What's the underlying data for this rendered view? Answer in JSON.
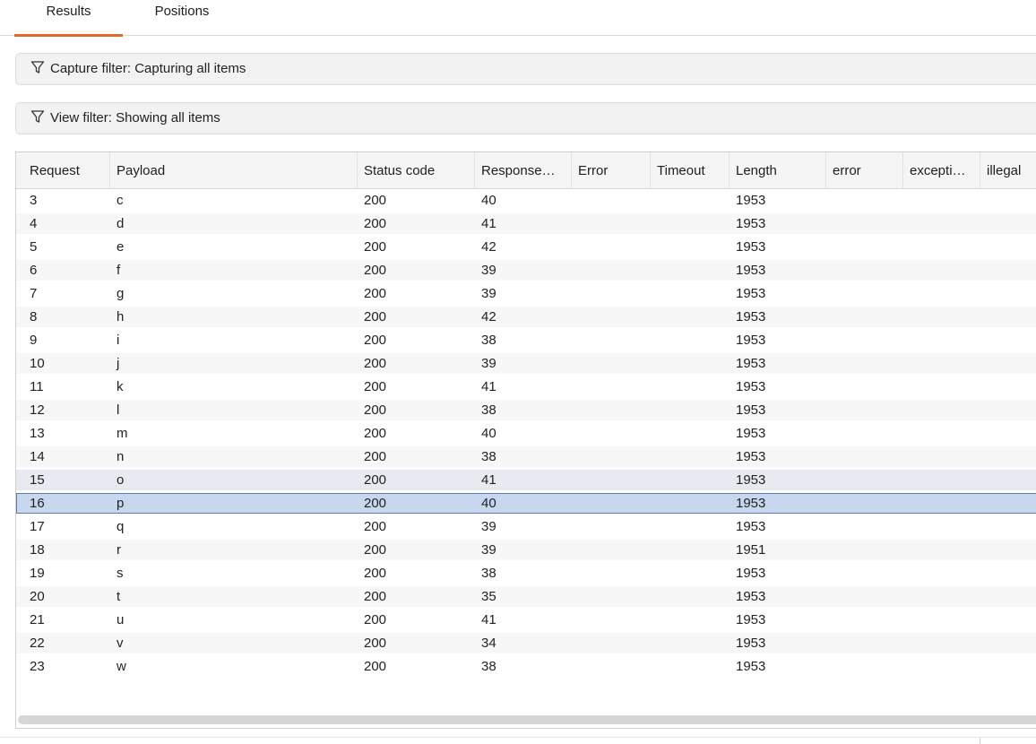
{
  "tabs": [
    {
      "label": "Results",
      "active": true
    },
    {
      "label": "Positions",
      "active": false
    }
  ],
  "filters": {
    "capture": "Capture filter: Capturing all items",
    "view": "View filter: Showing all items",
    "icon": "filter-funnel-icon"
  },
  "table": {
    "columns": [
      "Request",
      "Payload",
      "Status code",
      "Response…",
      "Error",
      "Timeout",
      "Length",
      "error",
      "excepti…",
      "illegal"
    ],
    "rows": [
      [
        "3",
        "c",
        "200",
        "40",
        "",
        "",
        "1953",
        "",
        "",
        ""
      ],
      [
        "4",
        "d",
        "200",
        "41",
        "",
        "",
        "1953",
        "",
        "",
        ""
      ],
      [
        "5",
        "e",
        "200",
        "42",
        "",
        "",
        "1953",
        "",
        "",
        ""
      ],
      [
        "6",
        "f",
        "200",
        "39",
        "",
        "",
        "1953",
        "",
        "",
        ""
      ],
      [
        "7",
        "g",
        "200",
        "39",
        "",
        "",
        "1953",
        "",
        "",
        ""
      ],
      [
        "8",
        "h",
        "200",
        "42",
        "",
        "",
        "1953",
        "",
        "",
        ""
      ],
      [
        "9",
        "i",
        "200",
        "38",
        "",
        "",
        "1953",
        "",
        "",
        ""
      ],
      [
        "10",
        "j",
        "200",
        "39",
        "",
        "",
        "1953",
        "",
        "",
        ""
      ],
      [
        "11",
        "k",
        "200",
        "41",
        "",
        "",
        "1953",
        "",
        "",
        ""
      ],
      [
        "12",
        "l",
        "200",
        "38",
        "",
        "",
        "1953",
        "",
        "",
        ""
      ],
      [
        "13",
        "m",
        "200",
        "40",
        "",
        "",
        "1953",
        "",
        "",
        ""
      ],
      [
        "14",
        "n",
        "200",
        "38",
        "",
        "",
        "1953",
        "",
        "",
        ""
      ],
      [
        "15",
        "o",
        "200",
        "41",
        "",
        "",
        "1953",
        "",
        "",
        ""
      ],
      [
        "16",
        "p",
        "200",
        "40",
        "",
        "",
        "1953",
        "",
        "",
        ""
      ],
      [
        "17",
        "q",
        "200",
        "39",
        "",
        "",
        "1953",
        "",
        "",
        ""
      ],
      [
        "18",
        "r",
        "200",
        "39",
        "",
        "",
        "1951",
        "",
        "",
        ""
      ],
      [
        "19",
        "s",
        "200",
        "38",
        "",
        "",
        "1953",
        "",
        "",
        ""
      ],
      [
        "20",
        "t",
        "200",
        "35",
        "",
        "",
        "1953",
        "",
        "",
        ""
      ],
      [
        "21",
        "u",
        "200",
        "41",
        "",
        "",
        "1953",
        "",
        "",
        ""
      ],
      [
        "22",
        "v",
        "200",
        "34",
        "",
        "",
        "1953",
        "",
        "",
        ""
      ],
      [
        "23",
        "w",
        "200",
        "38",
        "",
        "",
        "1953",
        "",
        "",
        ""
      ]
    ],
    "hovered_request": "15",
    "selected_request": "16"
  },
  "colors": {
    "accent": "#e06a2c",
    "selected_row": "#c6d7ee",
    "hover_row": "#e7ebf1"
  }
}
